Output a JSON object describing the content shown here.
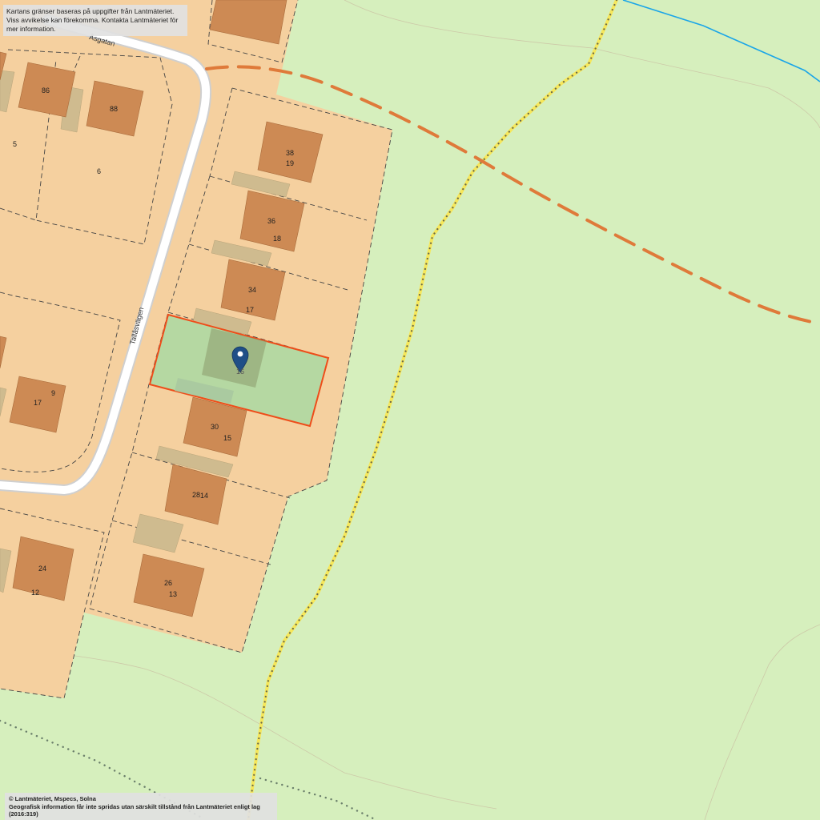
{
  "notice": {
    "line1": "Kartans gränser baseras på uppgifter från Lantmäteriet.",
    "line2": "Viss avvikelse kan förekomma. Kontakta Lantmäteriet för mer information."
  },
  "copyright": {
    "line1": "© Lantmäteriet, Mspecs, Solna",
    "line2": "Geografisk information får inte spridas utan särskilt tillstånd från Lantmäteriet enligt lag (2016:319)"
  },
  "streets": {
    "asgatan": "Åsgatan",
    "tallasvagen": "Tallåsvägen"
  },
  "labels": {
    "n86": "86",
    "n88": "88",
    "n5": "5",
    "n6": "6",
    "n38": "38",
    "n19": "19",
    "n36": "36",
    "n18": "18",
    "n34": "34",
    "n17a": "17",
    "n16": "16",
    "n30": "30",
    "n15": "15",
    "n28": "28",
    "n14": "14",
    "n26": "26",
    "n13": "13",
    "n24": "24",
    "n12": "12",
    "n17b": "17",
    "n9": "9"
  },
  "colors": {
    "land": "#d6efbd",
    "residential": "#f5d09f",
    "building": "#cd8a54",
    "annex": "#cfbb8f",
    "road": "#ffffff",
    "road_edge": "#cfcfcf",
    "selected_fill": "#a9d9a2",
    "selected_outline": "#ee4d1a",
    "marker": "#1f4f87",
    "path_orange": "#df7a3a",
    "path_yellow": "#f6e75a",
    "stream": "#1aa5e8",
    "boundary": "#444444"
  },
  "icons": {
    "marker": "map-pin-icon"
  }
}
